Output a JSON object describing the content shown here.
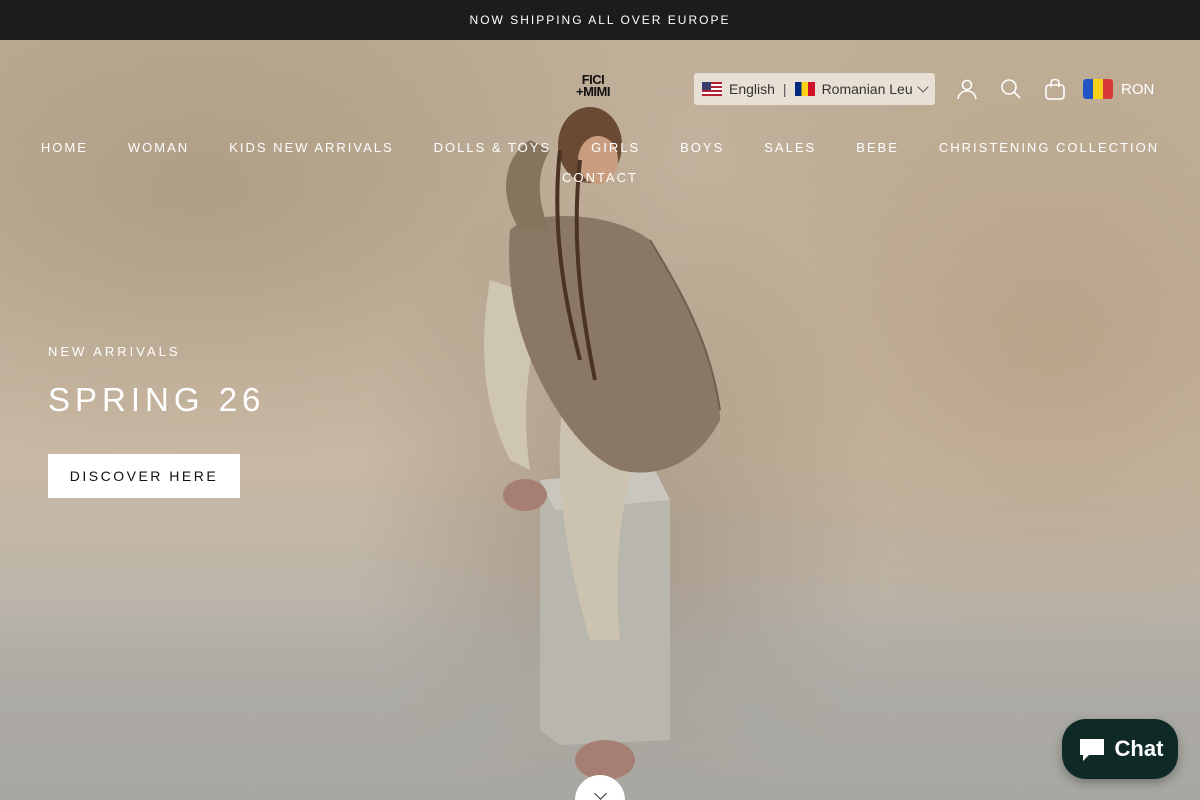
{
  "announcement": {
    "text": "NOW SHIPPING ALL OVER EUROPE"
  },
  "header": {
    "logo": {
      "line1": "FICI",
      "line2": "+MIMI"
    },
    "locale": {
      "language": "English",
      "separator": "|",
      "currency_name": "Romanian Leu"
    },
    "currency": {
      "code": "RON"
    },
    "icons": [
      "user-icon",
      "search-icon",
      "shopping-bag-icon"
    ]
  },
  "nav": {
    "items": [
      {
        "label": "HOME"
      },
      {
        "label": "WOMAN"
      },
      {
        "label": "KIDS NEW ARRIVALS"
      },
      {
        "label": "DOLLS & TOYS"
      },
      {
        "label": "GIRLS"
      },
      {
        "label": "BOYS"
      },
      {
        "label": "SALES"
      },
      {
        "label": "BEBE"
      },
      {
        "label": "CHRISTENING COLLECTION"
      },
      {
        "label": "CONTACT"
      }
    ]
  },
  "hero": {
    "eyebrow": "NEW ARRIVALS",
    "title": "SPRING 26",
    "cta": "DISCOVER HERE"
  },
  "chat": {
    "label": "Chat"
  },
  "colors": {
    "announcement_bg": "#1c1c1c",
    "chat_bg": "#0f2a26"
  }
}
